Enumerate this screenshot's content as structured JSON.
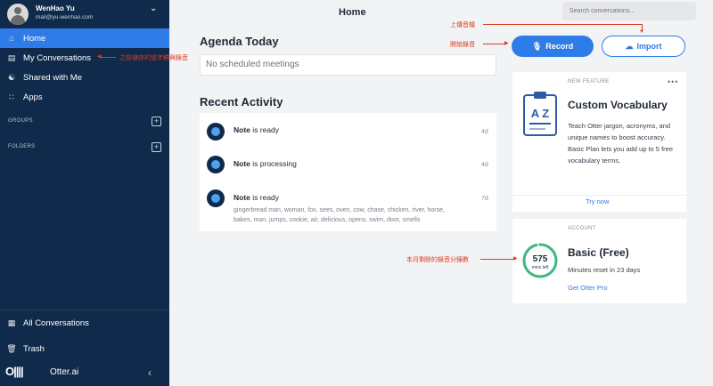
{
  "user": {
    "name": "WenHao Yu",
    "email": "mail@yu-wenhao.com"
  },
  "sidebar": {
    "items": [
      {
        "label": "Home",
        "icon": "home-icon"
      },
      {
        "label": "My Conversations",
        "icon": "document-icon"
      },
      {
        "label": "Shared with Me",
        "icon": "people-icon"
      },
      {
        "label": "Apps",
        "icon": "grid-icon"
      }
    ],
    "groups_label": "GROUPS",
    "folders_label": "FOLDERS",
    "all_conversations": "All Conversations",
    "trash": "Trash",
    "brand": "Otter.ai"
  },
  "header": {
    "title": "Home",
    "search_placeholder": "Search conversations..."
  },
  "agenda": {
    "title": "Agenda Today",
    "empty_text": "No scheduled meetings"
  },
  "activity": {
    "title": "Recent Activity",
    "items": [
      {
        "name": "Note",
        "status": "is ready",
        "age": "4d"
      },
      {
        "name": "Note",
        "status": "is processing",
        "age": "4d"
      },
      {
        "name": "Note",
        "status": "is ready",
        "age": "7d",
        "keywords": "gingerbread man, woman, fox, sees, oven, cow, chase, chicken, river, horse, bakes, man, jumps, cookie, air, delicious, opens, swim, door, smells"
      }
    ]
  },
  "actions": {
    "record": "Record",
    "import": "Import"
  },
  "feature_card": {
    "label": "NEW FEATURE",
    "title": "Custom Vocabulary",
    "description": "Teach Otter jargon, acronyms, and unique names to boost accuracy. Basic Plan lets you add up to 5 free vocabulary terms.",
    "link": "Try now",
    "icon_text": "A Z"
  },
  "account_card": {
    "label": "ACCOUNT",
    "title": "Basic (Free)",
    "minutes": "575",
    "minutes_unit": "mins left",
    "reset_text": "Minutes reset in 23 days",
    "link": "Get Otter Pro",
    "minutes_fraction": 0.96
  },
  "annotations": {
    "my_conversations": "之前儲存的逐字稿與錄音",
    "upload": "上傳音檔",
    "record": "開始錄音",
    "minutes": "本月剩餘的錄音分鐘數"
  },
  "colors": {
    "sidebar": "#0f2a4a",
    "accent": "#2e7ce8",
    "annotation": "#dd3b1f",
    "ring": "#3fb87f"
  }
}
